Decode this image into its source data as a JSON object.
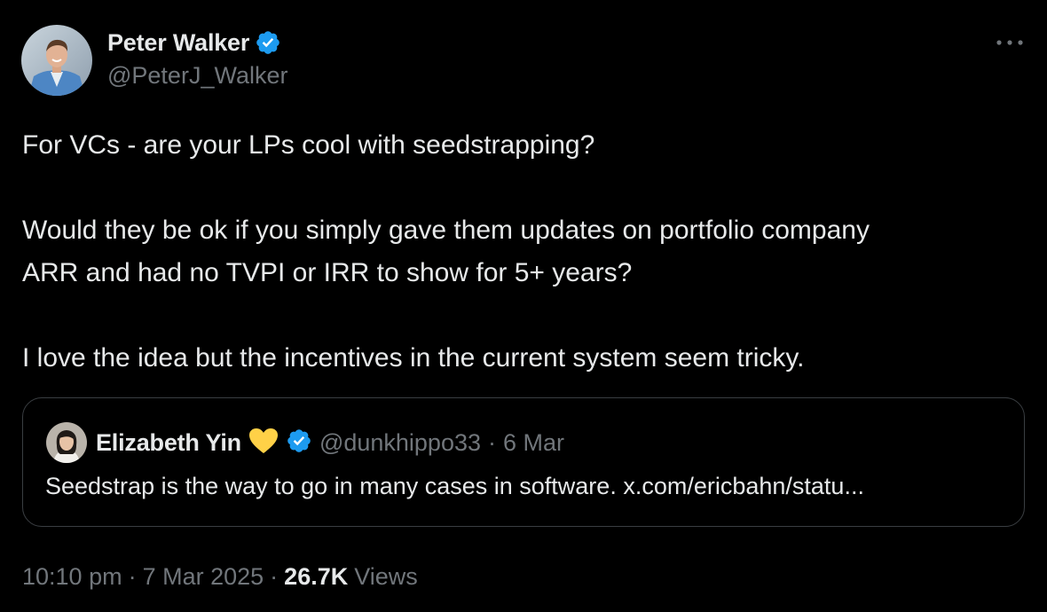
{
  "author": {
    "name": "Peter Walker",
    "handle": "@PeterJ_Walker",
    "verified": true
  },
  "tweet": {
    "paragraphs": [
      "For VCs - are your LPs cool with seedstrapping?",
      "Would they be ok if you simply gave them updates on portfolio company",
      "ARR and had no TVPI or IRR to show for 5+ years?",
      "I love the idea but the incentives in the current system seem tricky."
    ]
  },
  "quote": {
    "name": "Elizabeth Yin",
    "emoji": "💛",
    "handle": "@dunkhippo33",
    "separator": "·",
    "date": "6 Mar",
    "text": "Seedstrap is the way to go in many cases in software. x.com/ericbahn/statu..."
  },
  "meta": {
    "time": "10:10 pm",
    "separator": "·",
    "date": "7 Mar 2025",
    "views_count": "26.7K",
    "views_label": "Views"
  },
  "colors": {
    "background": "#000000",
    "primary_text": "#e7e9ea",
    "secondary_text": "#71767b",
    "verified_blue": "#1d9bf0",
    "border": "#3a3e42",
    "heart_yellow": "#ffd147"
  },
  "icons": {
    "more": "more-horizontal-icon",
    "verified": "verified-badge-icon"
  }
}
